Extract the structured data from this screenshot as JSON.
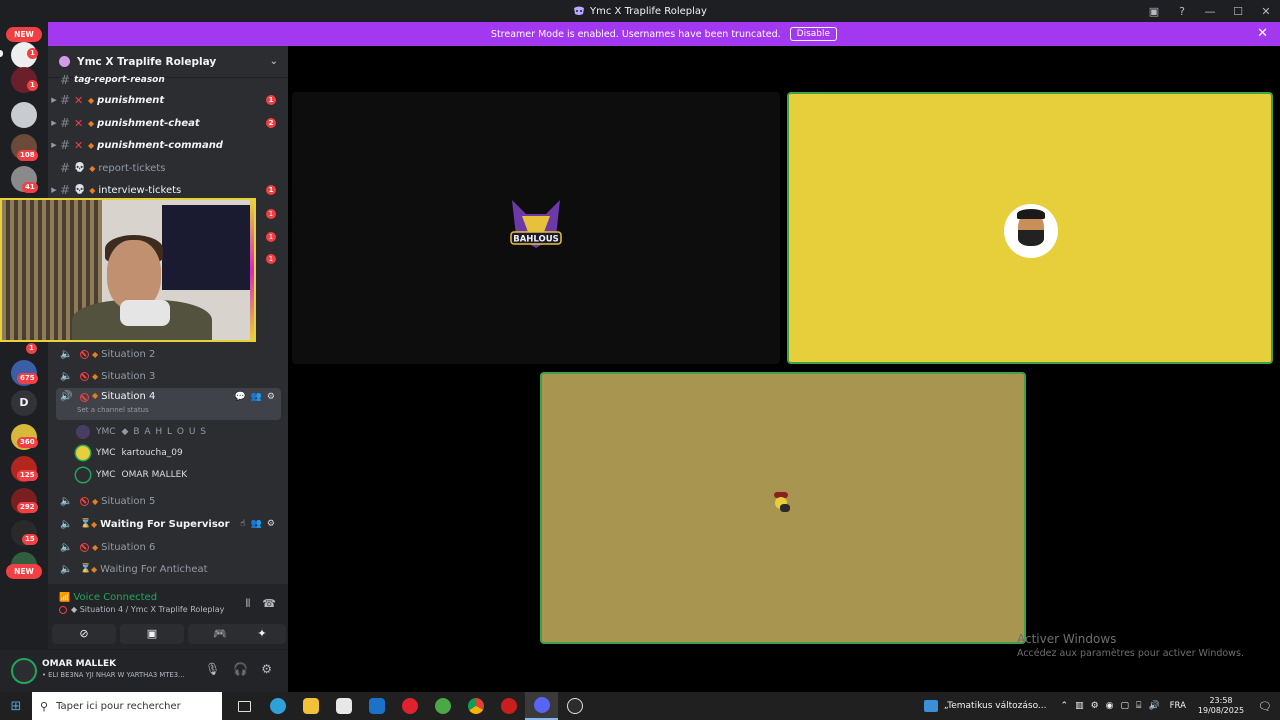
{
  "window": {
    "title": "Ymc X Traplife Roleplay",
    "controls": [
      "—",
      "☐",
      "✕"
    ]
  },
  "banner": {
    "message": "Streamer Mode is enabled. Usernames have been truncated.",
    "button": "Disable"
  },
  "rail": {
    "new_top": "NEW",
    "new_bottom": "NEW",
    "badges": [
      "1",
      "1",
      "108",
      "41",
      "1",
      "675",
      "360",
      "125",
      "292",
      "15"
    ],
    "letter_server": "D"
  },
  "server": {
    "name": "Ymc X Traplife Roleplay"
  },
  "channels": [
    {
      "name": "tag-report-reason",
      "mention": ""
    },
    {
      "name": "punishment",
      "mention": "1"
    },
    {
      "name": "punishment-cheat",
      "mention": "2"
    },
    {
      "name": "punishment-command",
      "mention": ""
    },
    {
      "name": "report-tickets",
      "mention": ""
    },
    {
      "name": "interview-tickets",
      "mention": "1"
    }
  ],
  "hidden_mentions": [
    "1",
    "1",
    "1"
  ],
  "voice_channels": [
    {
      "name": "Situation 2"
    },
    {
      "name": "Situation 3"
    },
    {
      "name": "Situation 4",
      "status": "Set a channel status"
    },
    {
      "name": "Situation 5"
    },
    {
      "name": "Waiting For Supervisor"
    },
    {
      "name": "Situation 6"
    },
    {
      "name": "Waiting For Anticheat"
    }
  ],
  "members": [
    {
      "tag": "YMC",
      "name": "◆ B A H L O U S"
    },
    {
      "tag": "YMC",
      "name": "kartoucha_09"
    },
    {
      "tag": "YMC",
      "name": "OMAR MALLEK"
    }
  ],
  "voice_panel": {
    "status": "Voice Connected",
    "channel": "◆ Situation 4 / Ymc X Traplife Roleplay"
  },
  "user": {
    "name": "OMAR MALLEK",
    "status": "• ELI BE3NA YJI NHAR W YARTHA3 MTE3..."
  },
  "tiles": {
    "bahlous_logo_text": "BAHLOUS"
  },
  "watermark": {
    "line1": "Activer Windows",
    "line2": "Accédez aux paramètres pour activer Windows."
  },
  "taskbar": {
    "search_placeholder": "Taper ici pour rechercher",
    "news": "„Tematikus változáso...",
    "lang": "FRA",
    "time": "23:58",
    "date": "19/08/2025"
  },
  "colors": {
    "banner": "#a239f0",
    "sidebar": "#2b2d31",
    "rail": "#1e1f22",
    "voice_connected": "#23a55a",
    "mention": "#f23f43",
    "tile_yellow": "#e6cf3a",
    "tile_olive": "#a89650",
    "speaking_border": "#3fa24b"
  }
}
